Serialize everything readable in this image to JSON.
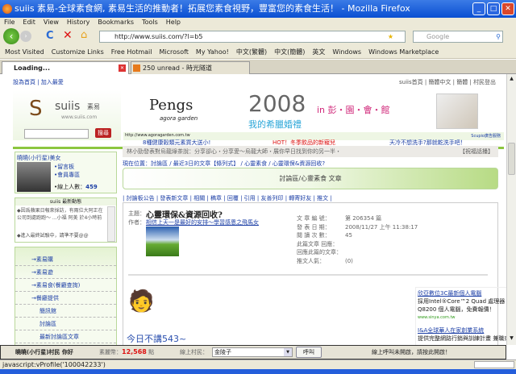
{
  "window": {
    "title": "suiis 素易-全球素食網, 素易生活的推動者！拓展您素食視野，豐富您的素食生活！ - Mozilla Firefox"
  },
  "menu": [
    "File",
    "Edit",
    "View",
    "History",
    "Bookmarks",
    "Tools",
    "Help"
  ],
  "address": {
    "url": "http://www.suiis.com/?l=b5",
    "search_placeholder": "Google"
  },
  "bookmarks": [
    "Most Visited",
    "Customize Links",
    "Free Hotmail",
    "Microsoft",
    "My Yahoo!",
    "中文(繁體)",
    "中文(簡體)",
    "英文",
    "Windows",
    "Windows Marketplace"
  ],
  "tabs": [
    {
      "label": "Loading..."
    },
    {
      "label": "250 unread - 時光隧道"
    }
  ],
  "page": {
    "top_left_links": "設為首頁 | 加入最愛",
    "top_right_links": [
      "suiis首頁",
      "簡體中文",
      "簡體",
      "村民登出"
    ],
    "logo": {
      "name": "suiis",
      "cn": "素易",
      "url": "www.suiis.com"
    },
    "search_button": "搜尋",
    "banner": {
      "brand": "Pengs",
      "brand_sub": "agora garden",
      "year": "2008",
      "subtitle": "我的希臘婚禮",
      "tagline": "in 彭・園・會・館",
      "url": "http://www.agoragarden.com.tw",
      "credit": "Scupio廣告服務"
    },
    "promos": [
      "8種健康穀類元素買大送小!",
      "HOT！冬季飲品的新寵兒",
      "天冷不想洗手?那就乾洗手吧！"
    ],
    "user": {
      "name": "曉曉(小行星)美女",
      "links": [
        "留言板",
        "會員專區"
      ],
      "online_label": "線上人數：",
      "online": "459"
    },
    "notice": "林小勁發表對烏龍綠茶說：分享卻心・分享愛～烏龍大師・展你早日找到你的另一半・",
    "notice_link": "【祝福話播】",
    "breadcrumb": "現在位置：討論區 / 最近3日的文章【條列式】 / 心靈素食 / 心靈環保&資源回收?",
    "section_title": "討論區/心靈素食 文章",
    "news": {
      "title": "suiis 最新動態",
      "items": [
        "◆因爲蘋果日報來採訪，有兩位大阿正在公司到處跑跑～ ...小福 阿美 於4小時前",
        "◆進入最終試驗中，請準不要@@"
      ]
    },
    "side_menu": [
      "→素易購",
      "→素易遊",
      "→素易食(餐廳查詢)",
      "→餐廳提供",
      "簡訊館",
      "討論區",
      "最新討論區文章"
    ],
    "toolbar_links": [
      "討論板公告",
      "發表新文章",
      "相關",
      "稿章",
      "回覆",
      "引用",
      "友善列印",
      "轉寄好友",
      "推文"
    ],
    "article": {
      "subject_label": "主題：",
      "subject": "心靈環保&資源回收?",
      "author_label": "作者：",
      "author": "相信上天一是最好的安排～學習感恩之飛馬女",
      "meta": [
        [
          "文 章 編 號：",
          "第 206354 篇"
        ],
        [
          "發 表 日 期：",
          "2008/11/27 上午 11:38:17"
        ],
        [
          "閱 讀 次 數：",
          "45"
        ],
        [
          "此篇文章 回應：",
          ""
        ],
        [
          "回應此篇的文章：",
          ""
        ],
        [
          "推文人氣：",
          "(0)"
        ]
      ],
      "body": "今日不講543~"
    },
    "ads": [
      {
        "title": "欣亞數位3C最新個人電腦",
        "text": "採用Intel®Core™2 Quad 處理器 Q8200 個人電腦，免費報價！",
        "url": "www.sinya.com.tw"
      },
      {
        "title": "I&A全球華人在家創業系統",
        "text": "提供完整網路行銷與訓練計畫 兼職或全"
      }
    ],
    "bottom": {
      "user": "曉曉(小行星)村民 你好",
      "points_label": "素麗幣：",
      "points": "12,568",
      "points_unit": "點",
      "online_label": "線上村民：",
      "online_select": "金陵子",
      "call_button": "呼叫",
      "call_status": "線上呼叫未開啟，請按此開啟！"
    }
  },
  "status": "javascript:vProfile('100042233')",
  "colors": {
    "accent_green": "#8cc63f",
    "link": "#1a3da5",
    "red": "#d11"
  }
}
